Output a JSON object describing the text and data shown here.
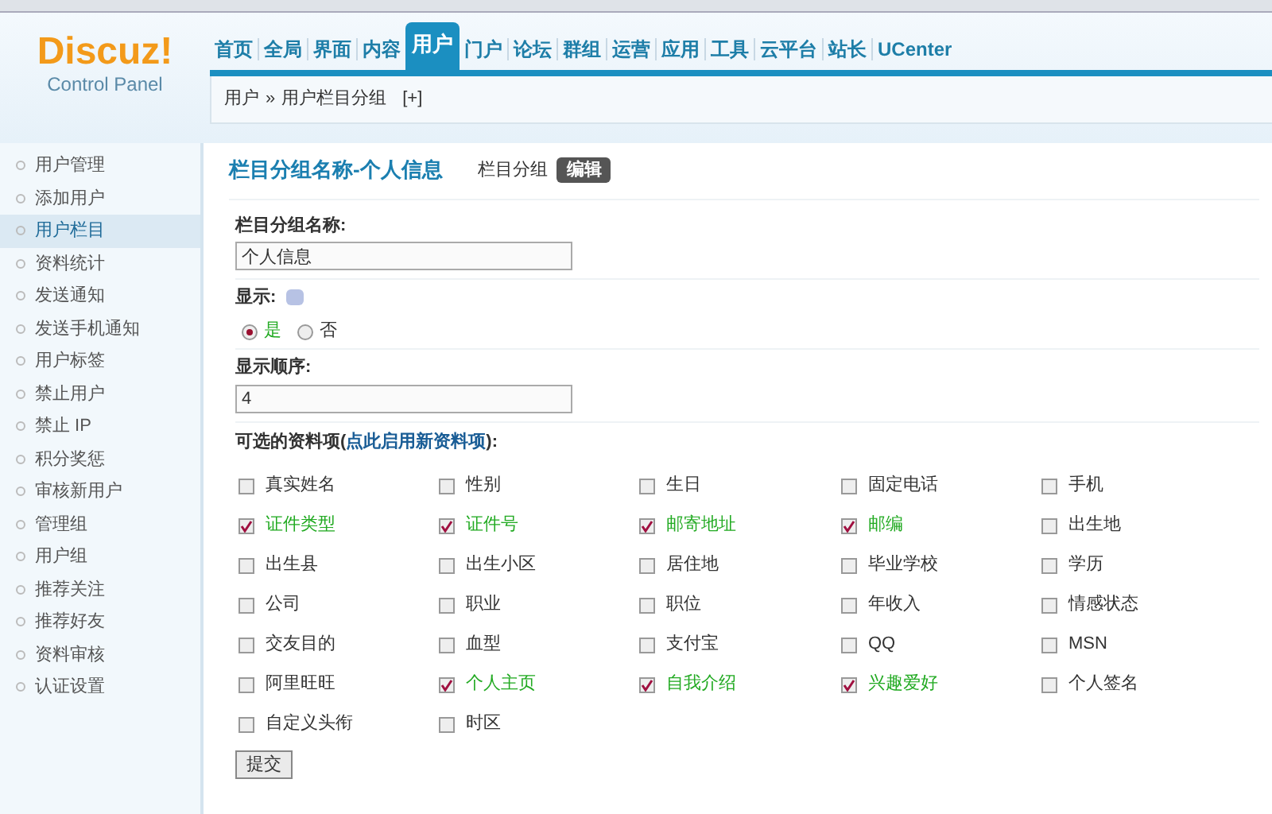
{
  "logo": {
    "name": "Discuz!",
    "subtitle": "Control Panel"
  },
  "nav": [
    {
      "label": "首页",
      "selected": false
    },
    {
      "label": "全局",
      "selected": false
    },
    {
      "label": "界面",
      "selected": false
    },
    {
      "label": "内容",
      "selected": false
    },
    {
      "label": "用户",
      "selected": true
    },
    {
      "label": "门户",
      "selected": false
    },
    {
      "label": "论坛",
      "selected": false
    },
    {
      "label": "群组",
      "selected": false
    },
    {
      "label": "运营",
      "selected": false
    },
    {
      "label": "应用",
      "selected": false
    },
    {
      "label": "工具",
      "selected": false
    },
    {
      "label": "云平台",
      "selected": false
    },
    {
      "label": "站长",
      "selected": false
    },
    {
      "label": "UCenter",
      "selected": false
    }
  ],
  "breadcrumb": {
    "items": [
      "用户",
      "用户栏目分组"
    ],
    "separator": "»",
    "add": "[+]"
  },
  "sidebar": {
    "items": [
      {
        "label": "用户管理",
        "selected": false
      },
      {
        "label": "添加用户",
        "selected": false
      },
      {
        "label": "用户栏目",
        "selected": true
      },
      {
        "label": "资料统计",
        "selected": false
      },
      {
        "label": "发送通知",
        "selected": false
      },
      {
        "label": "发送手机通知",
        "selected": false
      },
      {
        "label": "用户标签",
        "selected": false
      },
      {
        "label": "禁止用户",
        "selected": false
      },
      {
        "label": "禁止 IP",
        "selected": false
      },
      {
        "label": "积分奖惩",
        "selected": false
      },
      {
        "label": "审核新用户",
        "selected": false
      },
      {
        "label": "管理组",
        "selected": false
      },
      {
        "label": "用户组",
        "selected": false
      },
      {
        "label": "推荐关注",
        "selected": false
      },
      {
        "label": "推荐好友",
        "selected": false
      },
      {
        "label": "资料审核",
        "selected": false
      },
      {
        "label": "认证设置",
        "selected": false
      }
    ]
  },
  "page": {
    "title": "栏目分组名称-个人信息",
    "tab": "栏目分组",
    "edit_button": "编辑"
  },
  "form": {
    "name_label": "栏目分组名称:",
    "name_value": "个人信息",
    "display_label": "显示:",
    "display_options": [
      {
        "label": "是",
        "selected": true
      },
      {
        "label": "否",
        "selected": false
      }
    ],
    "order_label": "显示顺序:",
    "order_value": "4",
    "fields_label": "可选的资料项(",
    "fields_link": "点此启用新资料项",
    "fields_label_end": "):",
    "fields": [
      {
        "label": "真实姓名",
        "checked": false
      },
      {
        "label": "性别",
        "checked": false
      },
      {
        "label": "生日",
        "checked": false
      },
      {
        "label": "固定电话",
        "checked": false
      },
      {
        "label": "手机",
        "checked": false
      },
      {
        "label": "证件类型",
        "checked": true
      },
      {
        "label": "证件号",
        "checked": true
      },
      {
        "label": "邮寄地址",
        "checked": true
      },
      {
        "label": "邮编",
        "checked": true
      },
      {
        "label": "出生地",
        "checked": false
      },
      {
        "label": "出生县",
        "checked": false
      },
      {
        "label": "出生小区",
        "checked": false
      },
      {
        "label": "居住地",
        "checked": false
      },
      {
        "label": "毕业学校",
        "checked": false
      },
      {
        "label": "学历",
        "checked": false
      },
      {
        "label": "公司",
        "checked": false
      },
      {
        "label": "职业",
        "checked": false
      },
      {
        "label": "职位",
        "checked": false
      },
      {
        "label": "年收入",
        "checked": false
      },
      {
        "label": "情感状态",
        "checked": false
      },
      {
        "label": "交友目的",
        "checked": false
      },
      {
        "label": "血型",
        "checked": false
      },
      {
        "label": "支付宝",
        "checked": false
      },
      {
        "label": "QQ",
        "checked": false
      },
      {
        "label": "MSN",
        "checked": false
      },
      {
        "label": "阿里旺旺",
        "checked": false
      },
      {
        "label": "个人主页",
        "checked": true
      },
      {
        "label": "自我介绍",
        "checked": true
      },
      {
        "label": "兴趣爱好",
        "checked": true
      },
      {
        "label": "个人签名",
        "checked": false
      },
      {
        "label": "自定义头衔",
        "checked": false
      },
      {
        "label": "时区",
        "checked": false
      }
    ],
    "submit": "提交"
  }
}
